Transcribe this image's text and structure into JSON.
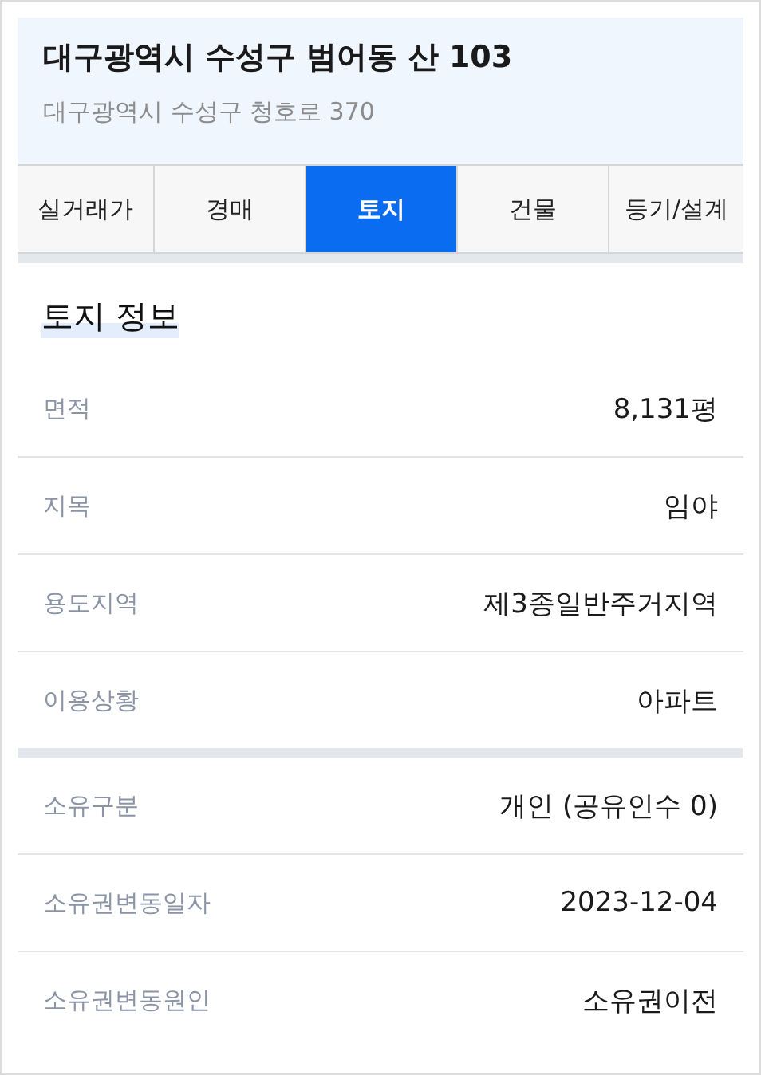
{
  "header": {
    "title": "대구광역시 수성구 범어동 산 103",
    "subtitle": "대구광역시 수성구 청호로 370"
  },
  "tabs": [
    {
      "label": "실거래가",
      "selected": false
    },
    {
      "label": "경매",
      "selected": false
    },
    {
      "label": "토지",
      "selected": true
    },
    {
      "label": "건물",
      "selected": false
    },
    {
      "label": "등기/설계",
      "selected": false
    }
  ],
  "section": {
    "title": "토지 정보",
    "groups": [
      {
        "rows": [
          {
            "label": "면적",
            "value": "8,131평"
          },
          {
            "label": "지목",
            "value": "임야"
          },
          {
            "label": "용도지역",
            "value": "제3종일반주거지역"
          },
          {
            "label": "이용상황",
            "value": "아파트"
          }
        ]
      },
      {
        "rows": [
          {
            "label": "소유구분",
            "value": "개인 (공유인수 0)"
          },
          {
            "label": "소유권변동일자",
            "value": "2023-12-04"
          },
          {
            "label": "소유권변동원인",
            "value": "소유권이전"
          }
        ]
      }
    ]
  }
}
